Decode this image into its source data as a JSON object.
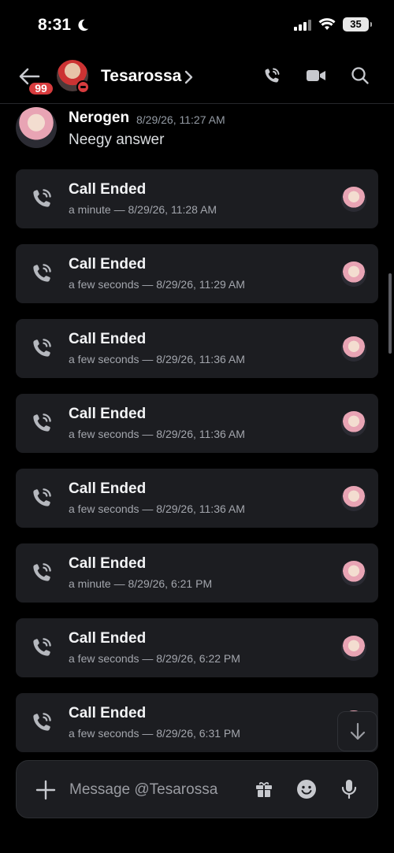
{
  "status_bar": {
    "time": "8:31",
    "battery": "35"
  },
  "header": {
    "unread_count": "99",
    "contact_name": "Tesarossa"
  },
  "message": {
    "author": "Nerogen",
    "timestamp": "8/29/26, 11:27 AM",
    "text": "Neegy answer"
  },
  "calls": [
    {
      "title": "Call Ended",
      "meta": "a minute — 8/29/26, 11:28 AM"
    },
    {
      "title": "Call Ended",
      "meta": "a few seconds — 8/29/26, 11:29 AM"
    },
    {
      "title": "Call Ended",
      "meta": "a few seconds — 8/29/26, 11:36 AM"
    },
    {
      "title": "Call Ended",
      "meta": "a few seconds — 8/29/26, 11:36 AM"
    },
    {
      "title": "Call Ended",
      "meta": "a few seconds — 8/29/26, 11:36 AM"
    },
    {
      "title": "Call Ended",
      "meta": "a minute — 8/29/26, 6:21 PM"
    },
    {
      "title": "Call Ended",
      "meta": "a few seconds — 8/29/26, 6:22 PM"
    },
    {
      "title": "Call Ended",
      "meta": "a few seconds — 8/29/26, 6:31 PM"
    }
  ],
  "composer": {
    "placeholder": "Message @Tesarossa"
  },
  "colors": {
    "background": "#000000",
    "card": "#1c1d21",
    "badge": "#d83c3e",
    "muted_text": "#a3a6ad"
  },
  "icons": {
    "back": "arrow-left-icon",
    "moon": "moon-icon",
    "wifi": "wifi-icon",
    "signal": "signal-icon",
    "chevron": "chevron-right-icon",
    "voice_call": "phone-call-icon",
    "video_call": "video-camera-icon",
    "search": "search-icon",
    "call_ended": "phone-ended-icon",
    "plus": "plus-icon",
    "gift": "gift-icon",
    "emoji": "emoji-icon",
    "mic": "microphone-icon",
    "jump": "arrow-down-icon"
  }
}
